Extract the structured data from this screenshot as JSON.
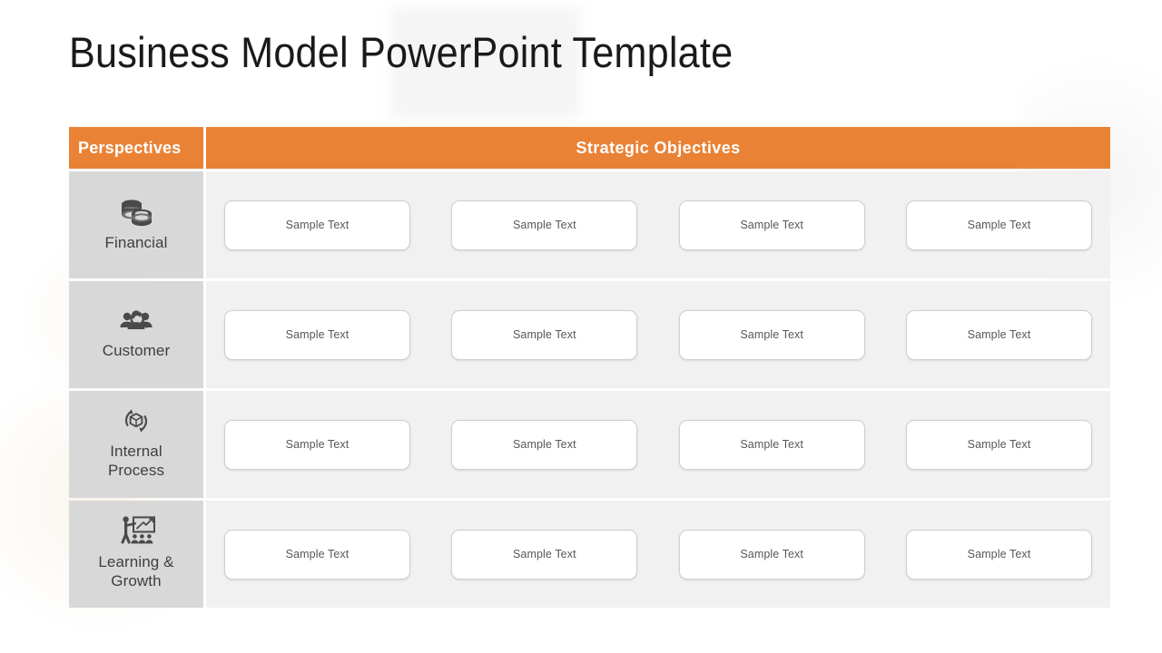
{
  "title": "Business Model PowerPoint Template",
  "colors": {
    "accent_orange": "#ea8236",
    "perspective_cell_bg": "#d8d8d8",
    "objective_row_bg": "#f1f1f1",
    "box_bg": "#ffffff",
    "box_border": "#cfcfcf",
    "label_text": "#3f3f3f",
    "sample_text": "#585858",
    "header_text": "#ffffff",
    "icon_color": "#4a4a4a"
  },
  "table": {
    "header": {
      "perspectives_label": "Perspectives",
      "objectives_label": "Strategic Objectives"
    },
    "rows": [
      {
        "perspective": "Financial",
        "icon": "stacked-coins-icon",
        "cells": [
          "Sample Text",
          "Sample Text",
          "Sample Text",
          "Sample Text"
        ]
      },
      {
        "perspective": "Customer",
        "icon": "people-magnifier-icon",
        "cells": [
          "Sample Text",
          "Sample Text",
          "Sample Text",
          "Sample Text"
        ]
      },
      {
        "perspective": "Internal\nProcess",
        "perspective_line1": "Internal",
        "perspective_line2": "Process",
        "icon": "box-cycle-arrows-icon",
        "cells": [
          "Sample Text",
          "Sample Text",
          "Sample Text",
          "Sample Text"
        ]
      },
      {
        "perspective": "Learning & Growth",
        "perspective_line1": "Learning &",
        "perspective_line2": "Growth",
        "icon": "presenter-audience-icon",
        "cells": [
          "Sample Text",
          "Sample Text",
          "Sample Text",
          "Sample Text"
        ]
      }
    ]
  }
}
